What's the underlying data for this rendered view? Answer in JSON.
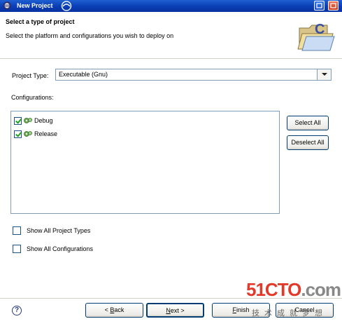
{
  "window": {
    "title": "New Project"
  },
  "header": {
    "heading": "Select a type of project",
    "description": "Select the platform and configurations you wish to deploy on"
  },
  "project_type": {
    "label": "Project Type:",
    "value": "Executable (Gnu)"
  },
  "configurations": {
    "label": "Configurations:",
    "items": [
      {
        "label": "Debug",
        "checked": true
      },
      {
        "label": "Release",
        "checked": true
      }
    ],
    "select_all": "Select All",
    "deselect_all": "Deselect All"
  },
  "options": {
    "show_all_project_types": "Show All Project Types",
    "show_all_configurations": "Show All Configurations"
  },
  "footer": {
    "back_prefix": "< ",
    "back_underline": "B",
    "back_rest": "ack",
    "next_underline": "N",
    "next_rest": "ext >",
    "finish_underline": "F",
    "finish_rest": "inish",
    "cancel": "Cancel",
    "help_glyph": "?"
  },
  "watermark": {
    "brand_digits": "51",
    "brand_letters": "CTO",
    "brand_suffix": ".com",
    "tagline": "技术成就梦想"
  },
  "colors": {
    "titlebar": "#0a3db4",
    "border": "#7f9db9",
    "button_border": "#003c74",
    "check": "#21a121",
    "watermark_red": "#e23a2a"
  }
}
